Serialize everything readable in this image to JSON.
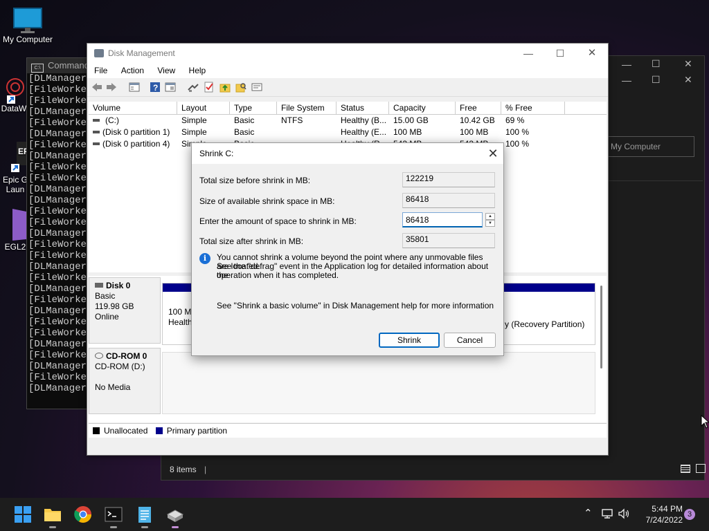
{
  "desktop": {
    "my_computer_label": "My Computer",
    "data_label": "DataW",
    "epic_label_1": "Epic G",
    "epic_label_2": "Laun",
    "egl_label": "EGL2"
  },
  "cmd": {
    "title": "Command",
    "lines": [
      "[DLManager]",
      "[FileWorker",
      "[FileWorker",
      "[DLManager]",
      "[FileWorker",
      "[DLManager]",
      "[FileWorker",
      "[DLManager]",
      "[FileWorker",
      "[FileWorker",
      "[DLManager]",
      "[DLManager]",
      "[FileWorker",
      "[FileWorker",
      "[DLManager]",
      "[FileWorker",
      "[FileWorker",
      "[DLManager]",
      "[FileWorker",
      "[DLManager]",
      "[FileWorker",
      "[DLManager]",
      "[FileWorker",
      "[FileWorker",
      "[DLManager]",
      "[FileWorker",
      "[DLManager]",
      "[FileWorker",
      "[DLManager]"
    ]
  },
  "explorer": {
    "address": "My Computer",
    "status_items": "8 items"
  },
  "diskmgmt": {
    "title": "Disk Management",
    "menu": [
      "File",
      "Action",
      "View",
      "Help"
    ],
    "columns": [
      "Volume",
      "Layout",
      "Type",
      "File System",
      "Status",
      "Capacity",
      "Free Spa...",
      "% Free"
    ],
    "rows": [
      {
        "volume": "(C:)",
        "layout": "Simple",
        "type": "Basic",
        "fs": "NTFS",
        "status": "Healthy (B...",
        "capacity": "15.00 GB",
        "free": "10.42 GB",
        "pct": "69 %"
      },
      {
        "volume": "(Disk 0 partition 1)",
        "layout": "Simple",
        "type": "Basic",
        "fs": "",
        "status": "Healthy (E...",
        "capacity": "100 MB",
        "free": "100 MB",
        "pct": "100 %"
      },
      {
        "volume": "(Disk 0 partition 4)",
        "layout": "Simple",
        "type": "Basic",
        "fs": "",
        "status": "Healthy (R...",
        "capacity": "543 MB",
        "free": "543 MB",
        "pct": "100 %"
      }
    ],
    "disk0": {
      "name": "Disk 0",
      "type": "Basic",
      "size": "119.98 GB",
      "state": "Online"
    },
    "disk0_part1": {
      "size": "100 MB",
      "status": "Healthy"
    },
    "disk0_recovery": "y (Recovery Partition)",
    "cdrom": {
      "name": "CD-ROM 0",
      "drive": "CD-ROM (D:)",
      "state": "No Media"
    },
    "legend": {
      "unallocated": "Unallocated",
      "primary": "Primary partition"
    },
    "colors": {
      "unallocated": "#000000",
      "primary": "#00008b"
    }
  },
  "shrink": {
    "title": "Shrink C:",
    "total_before_label": "Total size before shrink in MB:",
    "total_before_value": "122219",
    "available_label": "Size of available shrink space in MB:",
    "available_value": "86418",
    "amount_label": "Enter the amount of space to shrink in MB:",
    "amount_value": "86418",
    "total_after_label": "Total size after shrink in MB:",
    "total_after_value": "35801",
    "info_line1": "You cannot shrink a volume beyond the point where any unmovable files are located.",
    "info_line2": "See the \"defrag\" event in the Application log for detailed information about the",
    "info_line3": "operation when it has completed.",
    "help_text": "See \"Shrink a basic volume\" in Disk Management help for more information",
    "shrink_button": "Shrink",
    "cancel_button": "Cancel"
  },
  "taskbar": {
    "time": "5:44 PM",
    "date": "7/24/2022",
    "notification_count": "3"
  }
}
